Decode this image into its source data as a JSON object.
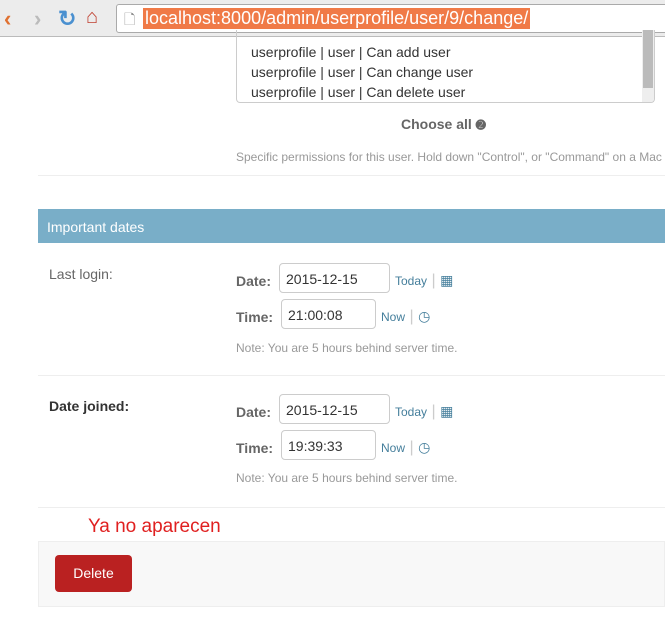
{
  "browser": {
    "url": "localhost:8000/admin/userprofile/user/9/change/"
  },
  "permissions": {
    "options": [
      "userprofile | user | Can add user",
      "userprofile | user | Can change user",
      "userprofile | user | Can delete user"
    ],
    "choose_all": "Choose all",
    "help": "Specific permissions for this user. Hold down \"Control\", or \"Command\" on a Mac"
  },
  "section": {
    "title": "Important dates"
  },
  "last_login": {
    "label": "Last login:",
    "date_label": "Date:",
    "date": "2015-12-15",
    "today": "Today",
    "time_label": "Time:",
    "time": "21:00:08",
    "now": "Now",
    "note": "Note: You are 5 hours behind server time."
  },
  "date_joined": {
    "label": "Date joined:",
    "date_label": "Date:",
    "date": "2015-12-15",
    "today": "Today",
    "time_label": "Time:",
    "time": "19:39:33",
    "now": "Now",
    "note": "Note: You are 5 hours behind server time."
  },
  "annotation": "Ya no aparecen",
  "submit": {
    "delete": "Delete"
  }
}
